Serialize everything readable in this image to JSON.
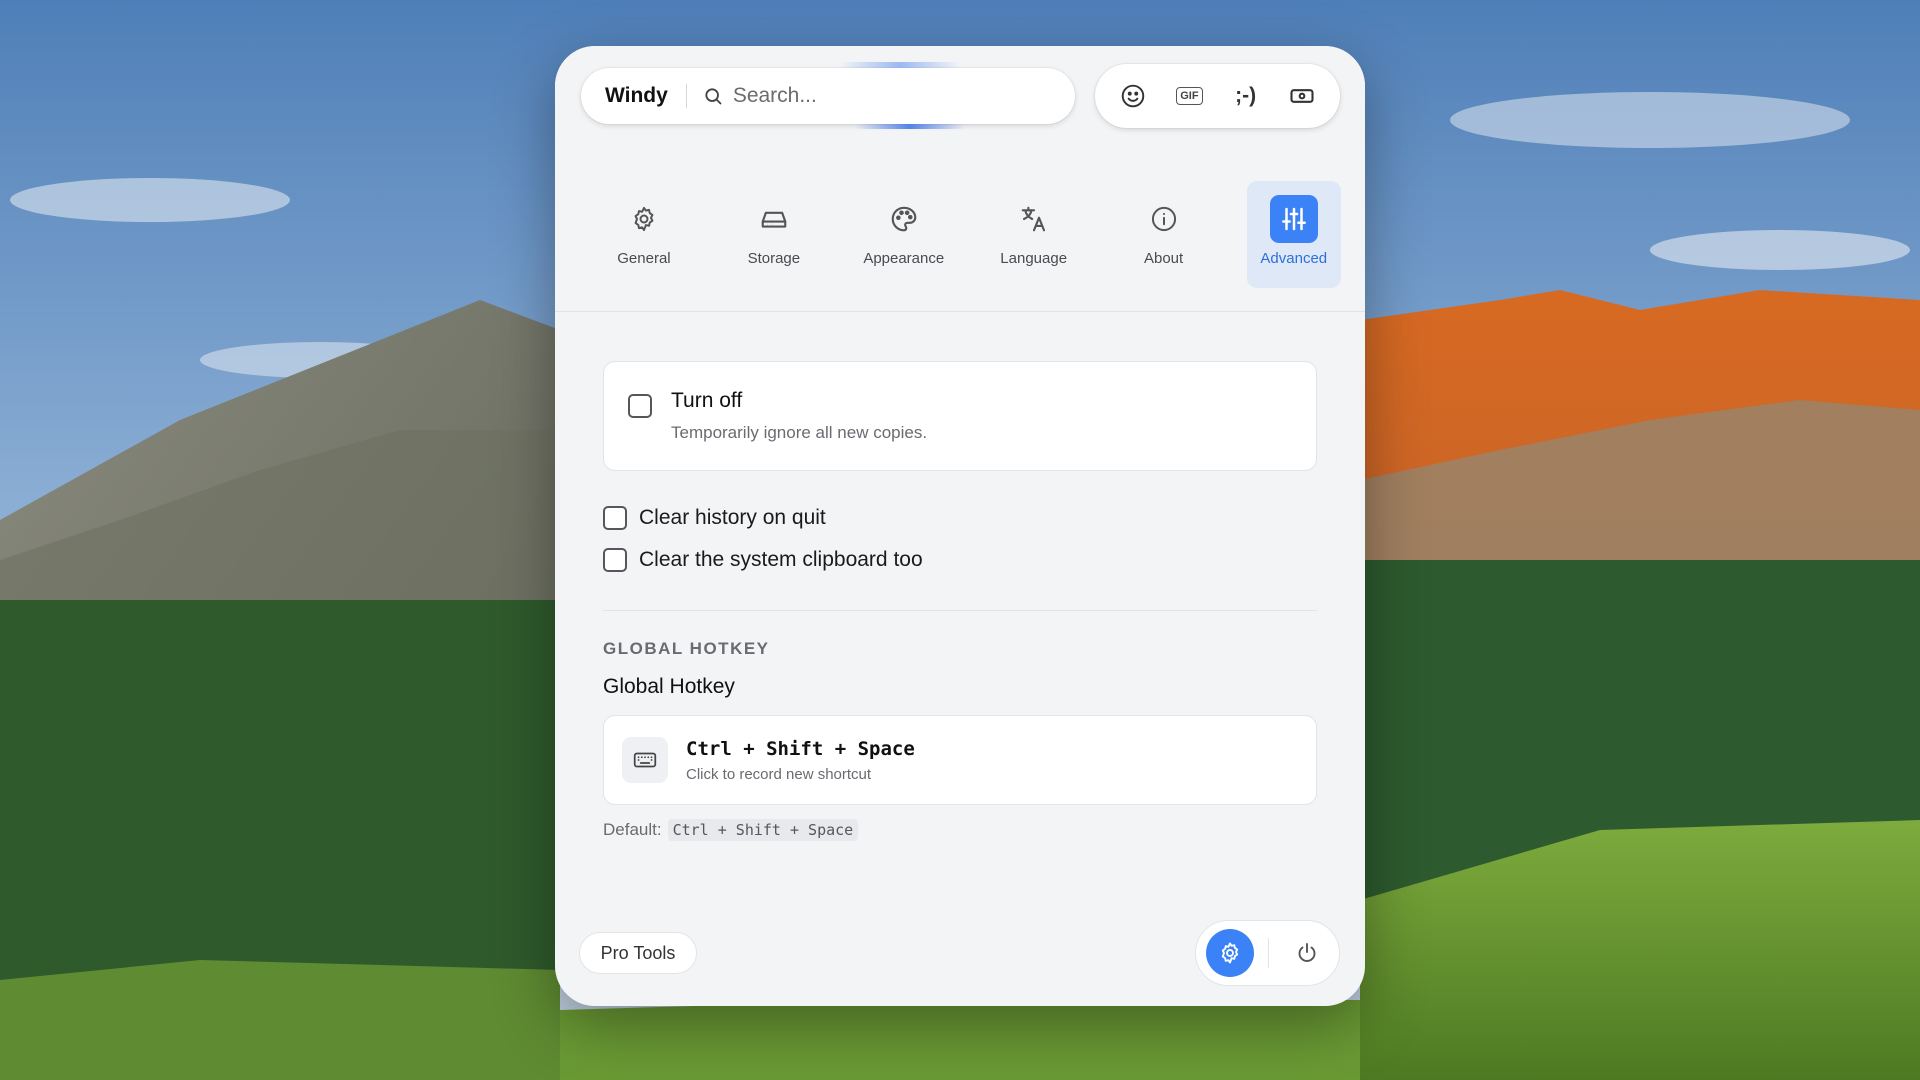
{
  "header": {
    "brand": "Windy",
    "search_placeholder": "Search...",
    "tools": {
      "emoji_icon": "smiley-icon",
      "gif_label": "GIF",
      "kaomoji_label": ";-)",
      "symbols_icon": "ticket-icon"
    }
  },
  "tabs": [
    {
      "label": "General",
      "icon": "gear-icon",
      "active": false
    },
    {
      "label": "Storage",
      "icon": "hard-drive-icon",
      "active": false
    },
    {
      "label": "Appearance",
      "icon": "palette-icon",
      "active": false
    },
    {
      "label": "Language",
      "icon": "translate-icon",
      "active": false
    },
    {
      "label": "About",
      "icon": "info-icon",
      "active": false
    },
    {
      "label": "Advanced",
      "icon": "sliders-icon",
      "active": true
    }
  ],
  "advanced": {
    "turn_off": {
      "title": "Turn off",
      "description": "Temporarily ignore all new copies.",
      "checked": false
    },
    "clear_history": {
      "label": "Clear history on quit",
      "checked": false
    },
    "clear_clipboard": {
      "label": "Clear the system clipboard too",
      "checked": false
    },
    "hotkey_section": {
      "eyebrow": "GLOBAL HOTKEY",
      "title": "Global Hotkey",
      "combo": "Ctrl + Shift + Space",
      "hint": "Click to record new shortcut",
      "default_label": "Default:",
      "default_combo": "Ctrl + Shift + Space"
    }
  },
  "footer": {
    "pro_tools_label": "Pro Tools"
  },
  "colors": {
    "accent": "#3b82f6",
    "active_tab_bg": "#dfe8f6",
    "window_bg": "#f3f4f6"
  }
}
